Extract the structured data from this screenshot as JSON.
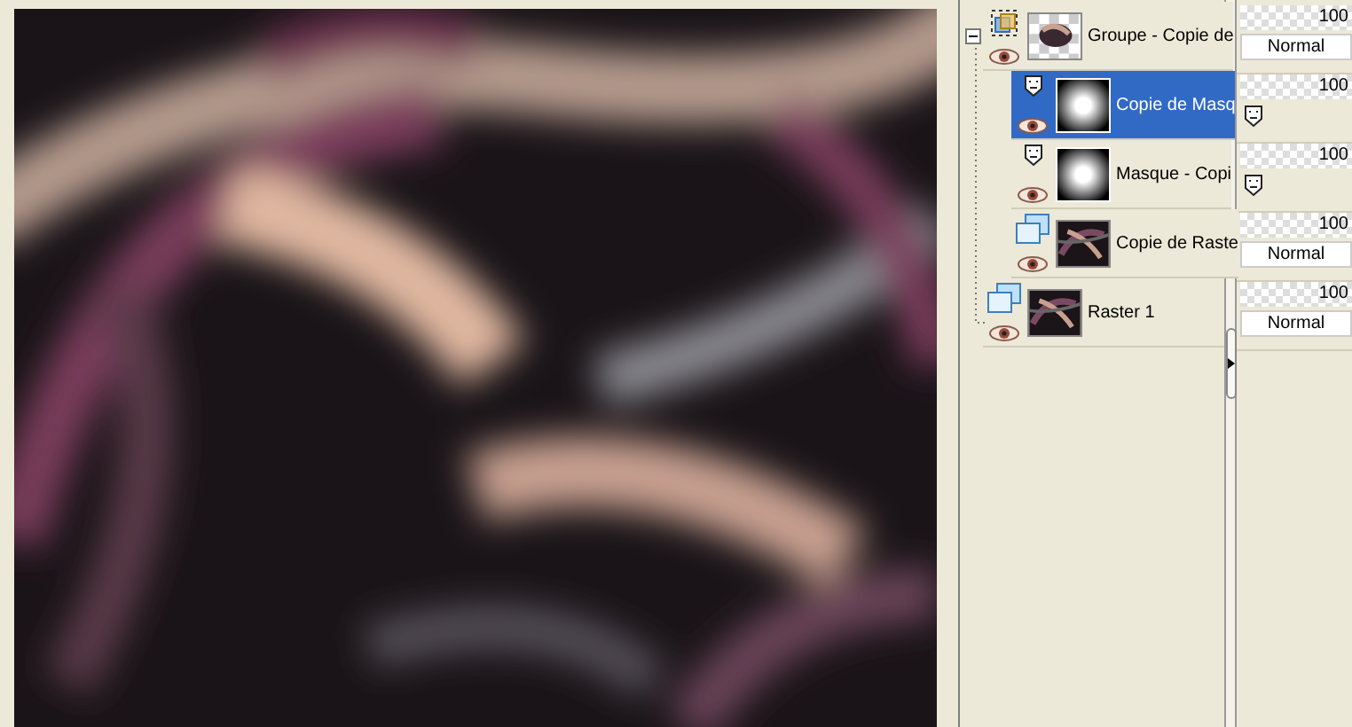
{
  "layers": [
    {
      "name": "Groupe - Copie de",
      "kind": "group",
      "selected": false,
      "expanded": true,
      "visible": true,
      "level": 1,
      "opacity": "100",
      "blend": "Normal",
      "children": [
        {
          "name": "Copie de Masq",
          "kind": "mask",
          "selected": true,
          "visible": true,
          "level": 1,
          "opacity": "100"
        },
        {
          "name": "Masque - Copi",
          "kind": "mask",
          "selected": false,
          "visible": true,
          "level": 1,
          "opacity": "100"
        },
        {
          "name": "Copie de Raste",
          "kind": "raster",
          "selected": false,
          "visible": true,
          "level": 1,
          "opacity": "100",
          "blend": "Normal"
        }
      ]
    },
    {
      "name": "Raster 1",
      "kind": "raster",
      "selected": false,
      "visible": true,
      "level": 1,
      "opacity": "100",
      "blend": "Normal"
    }
  ]
}
